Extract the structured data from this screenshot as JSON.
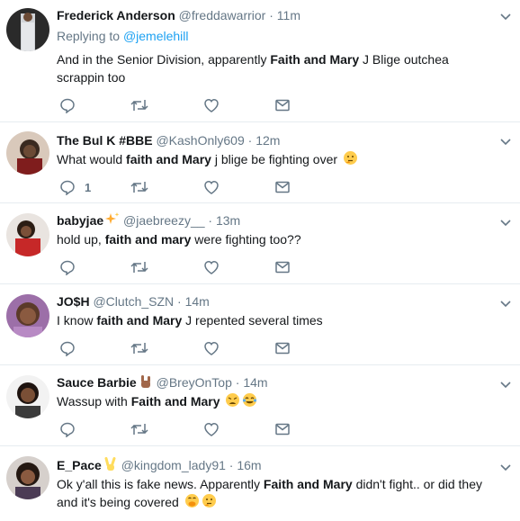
{
  "tweets": [
    {
      "name": "Frederick Anderson",
      "badge": "",
      "handle": "@freddawarrior",
      "dot": "·",
      "time": "11m",
      "reply_prefix": "Replying to ",
      "reply_to": "@jemelehill",
      "text_parts": [
        "And in the Senior Division, apparently ",
        "Faith and Mary",
        " J Blige outchea scrappin too"
      ],
      "reply_count": "",
      "emoji": []
    },
    {
      "name": "The Bul K #BBE",
      "badge": "",
      "handle": "@KashOnly609",
      "dot": "·",
      "time": "12m",
      "text_parts": [
        "What would ",
        "faith and Mary",
        " j blige be fighting over"
      ],
      "reply_count": "1",
      "emoji": [
        "thinking-face"
      ]
    },
    {
      "name": "babyjae",
      "badge": "sparkles",
      "handle": "@jaebreezy__",
      "dot": "·",
      "time": "13m",
      "text_parts": [
        "hold up, ",
        "faith and mary",
        " were fighting too??"
      ],
      "reply_count": "",
      "emoji": []
    },
    {
      "name": "JO$H",
      "badge": "",
      "handle": "@Clutch_SZN",
      "dot": "·",
      "time": "14m",
      "text_parts": [
        "I know ",
        "faith and Mary",
        " J repented several times"
      ],
      "reply_count": "",
      "emoji": []
    },
    {
      "name": "Sauce Barbie",
      "badge": "sign-of-horns",
      "handle": "@BreyOnTop",
      "dot": "·",
      "time": "14m",
      "text_parts": [
        "Wassup with ",
        "Faith and Mary",
        ""
      ],
      "reply_count": "",
      "emoji": [
        "weary-face",
        "tears-of-joy-face"
      ]
    },
    {
      "name": "E_Pace",
      "badge": "victory-hand",
      "handle": "@kingdom_lady91",
      "dot": "·",
      "time": "16m",
      "text_parts": [
        "Ok y'all this is fake news. Apparently ",
        "Faith and Mary",
        " didn't fight.. or did they and it's being covered"
      ],
      "reply_count": "",
      "emoji": [
        "hand-over-mouth-face",
        "thinking-face"
      ]
    }
  ],
  "colors": {
    "link": "#1da1f2",
    "secondary": "#657786",
    "border": "#e6ecf0",
    "text": "#14171a"
  }
}
